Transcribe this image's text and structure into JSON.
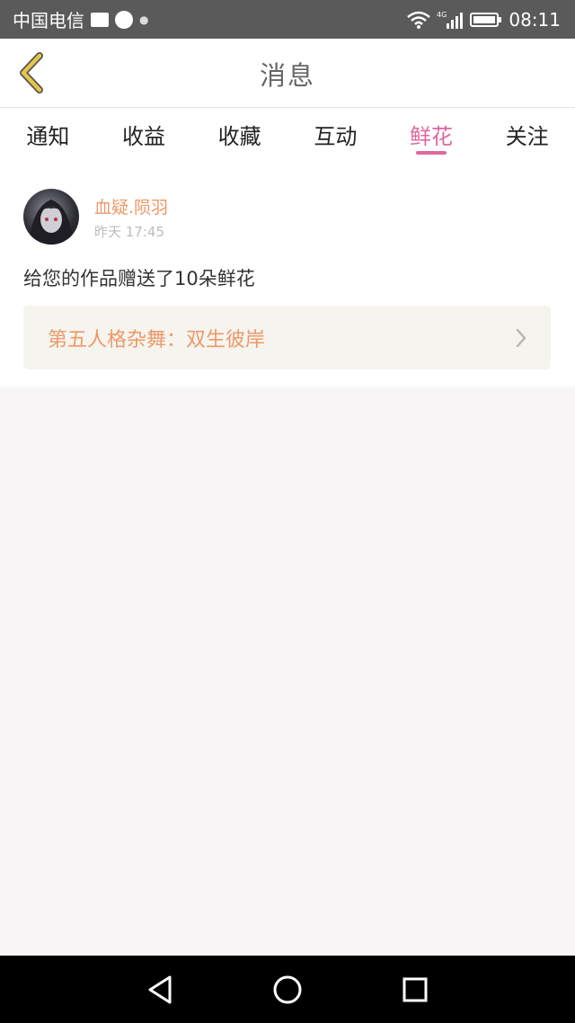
{
  "status_bar": {
    "carrier": "中国电信",
    "network": "4G",
    "time": "08:11"
  },
  "header": {
    "back_icon": "chevron-left-icon",
    "title": "消息"
  },
  "tabs": [
    {
      "label": "通知",
      "active": false
    },
    {
      "label": "收益",
      "active": false
    },
    {
      "label": "收藏",
      "active": false
    },
    {
      "label": "互动",
      "active": false
    },
    {
      "label": "鲜花",
      "active": true
    },
    {
      "label": "关注",
      "active": false
    }
  ],
  "message_item": {
    "username": "血疑.陨羽",
    "time": "昨天 17:45",
    "text": "给您的作品赠送了10朵鲜花",
    "work_title": "第五人格杂舞：双生彼岸",
    "work_arrow_icon": "chevron-right-icon"
  },
  "nav_bar": {
    "back_icon": "triangle-back-icon",
    "home_icon": "circle-home-icon",
    "recents_icon": "square-recents-icon"
  },
  "colors": {
    "accent_pink": "#e0679f",
    "accent_orange": "#ec9a6a",
    "back_chevron": "#d8b53c",
    "card_bg": "#f6f4ee"
  }
}
